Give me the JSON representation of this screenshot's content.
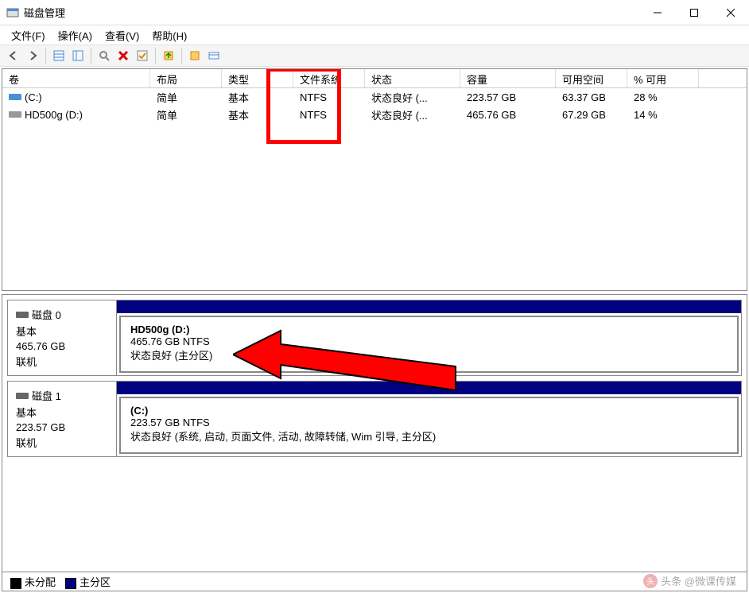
{
  "window": {
    "title": "磁盘管理"
  },
  "menu": {
    "file": "文件(F)",
    "action": "操作(A)",
    "view": "查看(V)",
    "help": "帮助(H)"
  },
  "columns": {
    "volume": "卷",
    "layout": "布局",
    "type": "类型",
    "filesystem": "文件系统",
    "status": "状态",
    "capacity": "容量",
    "free": "可用空间",
    "pct": "% 可用"
  },
  "volumes": [
    {
      "name": "(C:)",
      "layout": "简单",
      "type": "基本",
      "fs": "NTFS",
      "status": "状态良好 (...",
      "capacity": "223.57 GB",
      "free": "63.37 GB",
      "pct": "28 %",
      "drive_icon": "hdd-blue"
    },
    {
      "name": "HD500g (D:)",
      "layout": "简单",
      "type": "基本",
      "fs": "NTFS",
      "status": "状态良好 (...",
      "capacity": "465.76 GB",
      "free": "67.29 GB",
      "pct": "14 %",
      "drive_icon": "hdd-gray"
    }
  ],
  "disks": [
    {
      "label": "磁盘 0",
      "type": "基本",
      "size": "465.76 GB",
      "online": "联机",
      "part_name": "HD500g  (D:)",
      "part_size": "465.76 GB NTFS",
      "part_status": "状态良好 (主分区)"
    },
    {
      "label": "磁盘 1",
      "type": "基本",
      "size": "223.57 GB",
      "online": "联机",
      "part_name": "(C:)",
      "part_size": "223.57 GB NTFS",
      "part_status": "状态良好 (系统, 启动, 页面文件, 活动, 故障转储, Wim 引导, 主分区)"
    }
  ],
  "legend": {
    "unallocated": "未分配",
    "primary": "主分区"
  },
  "watermark": "头条 @微课传媒"
}
